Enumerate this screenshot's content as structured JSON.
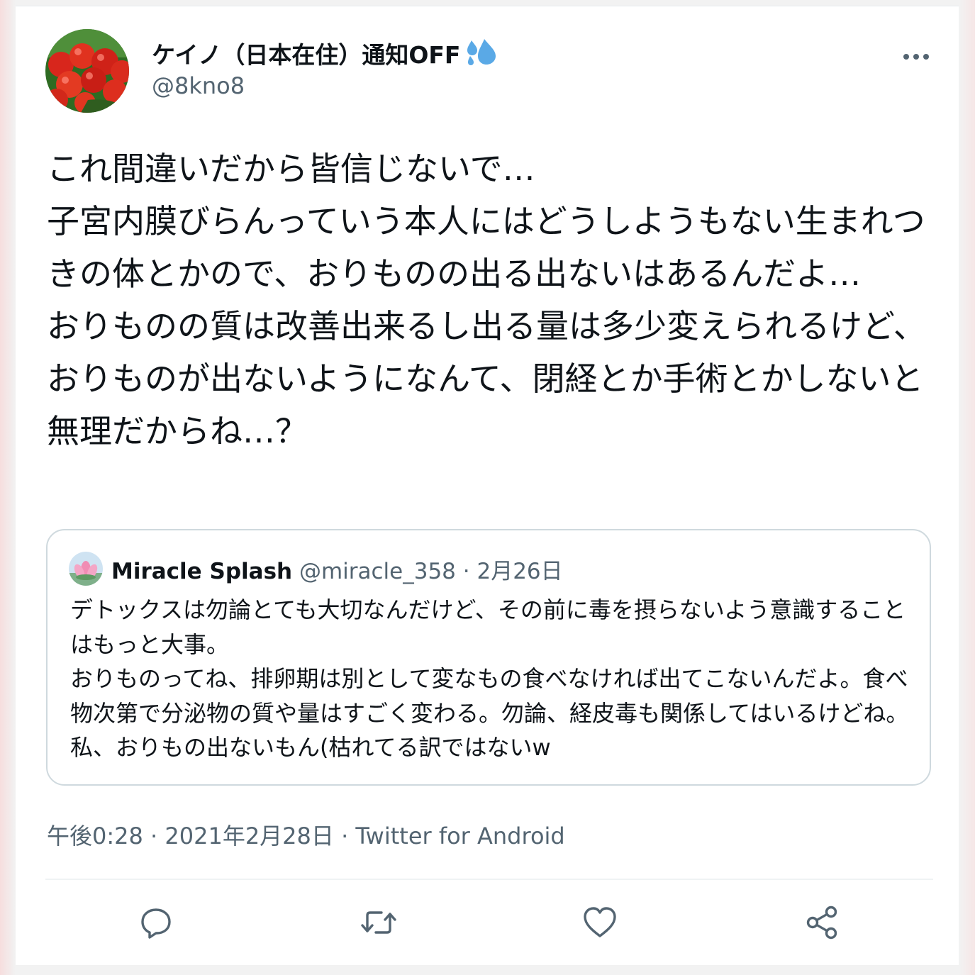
{
  "author": {
    "display_name": "ケイノ（日本在住）通知OFF",
    "handle": "@8kno8",
    "badge_icon": "sweat-droplets-icon"
  },
  "tweet": {
    "text": "これ間違いだから皆信じないで…\n子宮内膜びらんっていう本人にはどうしようもない生まれつきの体とかので、おりものの出る出ないはあるんだよ…\nおりものの質は改善出来るし出る量は多少変えられるけど、おりものが出ないようになんて、閉経とか手術とかしないと無理だからね…？"
  },
  "quote": {
    "author_name": "Miracle Splash",
    "meta": "@miracle_358 · 2月26日",
    "text": "デトックスは勿論とても大切なんだけど、その前に毒を摂らないよう意識することはもっと大事。\nおりものってね、排卵期は別として変なもの食べなければ出てこないんだよ。食べ物次第で分泌物の質や量はすごく変わる。勿論、経皮毒も関係してはいるけどね。私、おりもの出ないもん(枯れてる訳ではないw"
  },
  "meta": {
    "timestamp_line": "午後0:28 · 2021年2月28日 · Twitter for Android"
  },
  "actions": {
    "reply_icon": "reply-icon",
    "retweet_icon": "retweet-icon",
    "like_icon": "like-heart-icon",
    "share_icon": "share-icon",
    "more_icon": "more-options-icon"
  },
  "colors": {
    "text_primary": "#0f1419",
    "text_secondary": "#536471",
    "border": "#cfd9de",
    "icon": "#536471",
    "droplet_blue": "#5aa9e6"
  }
}
